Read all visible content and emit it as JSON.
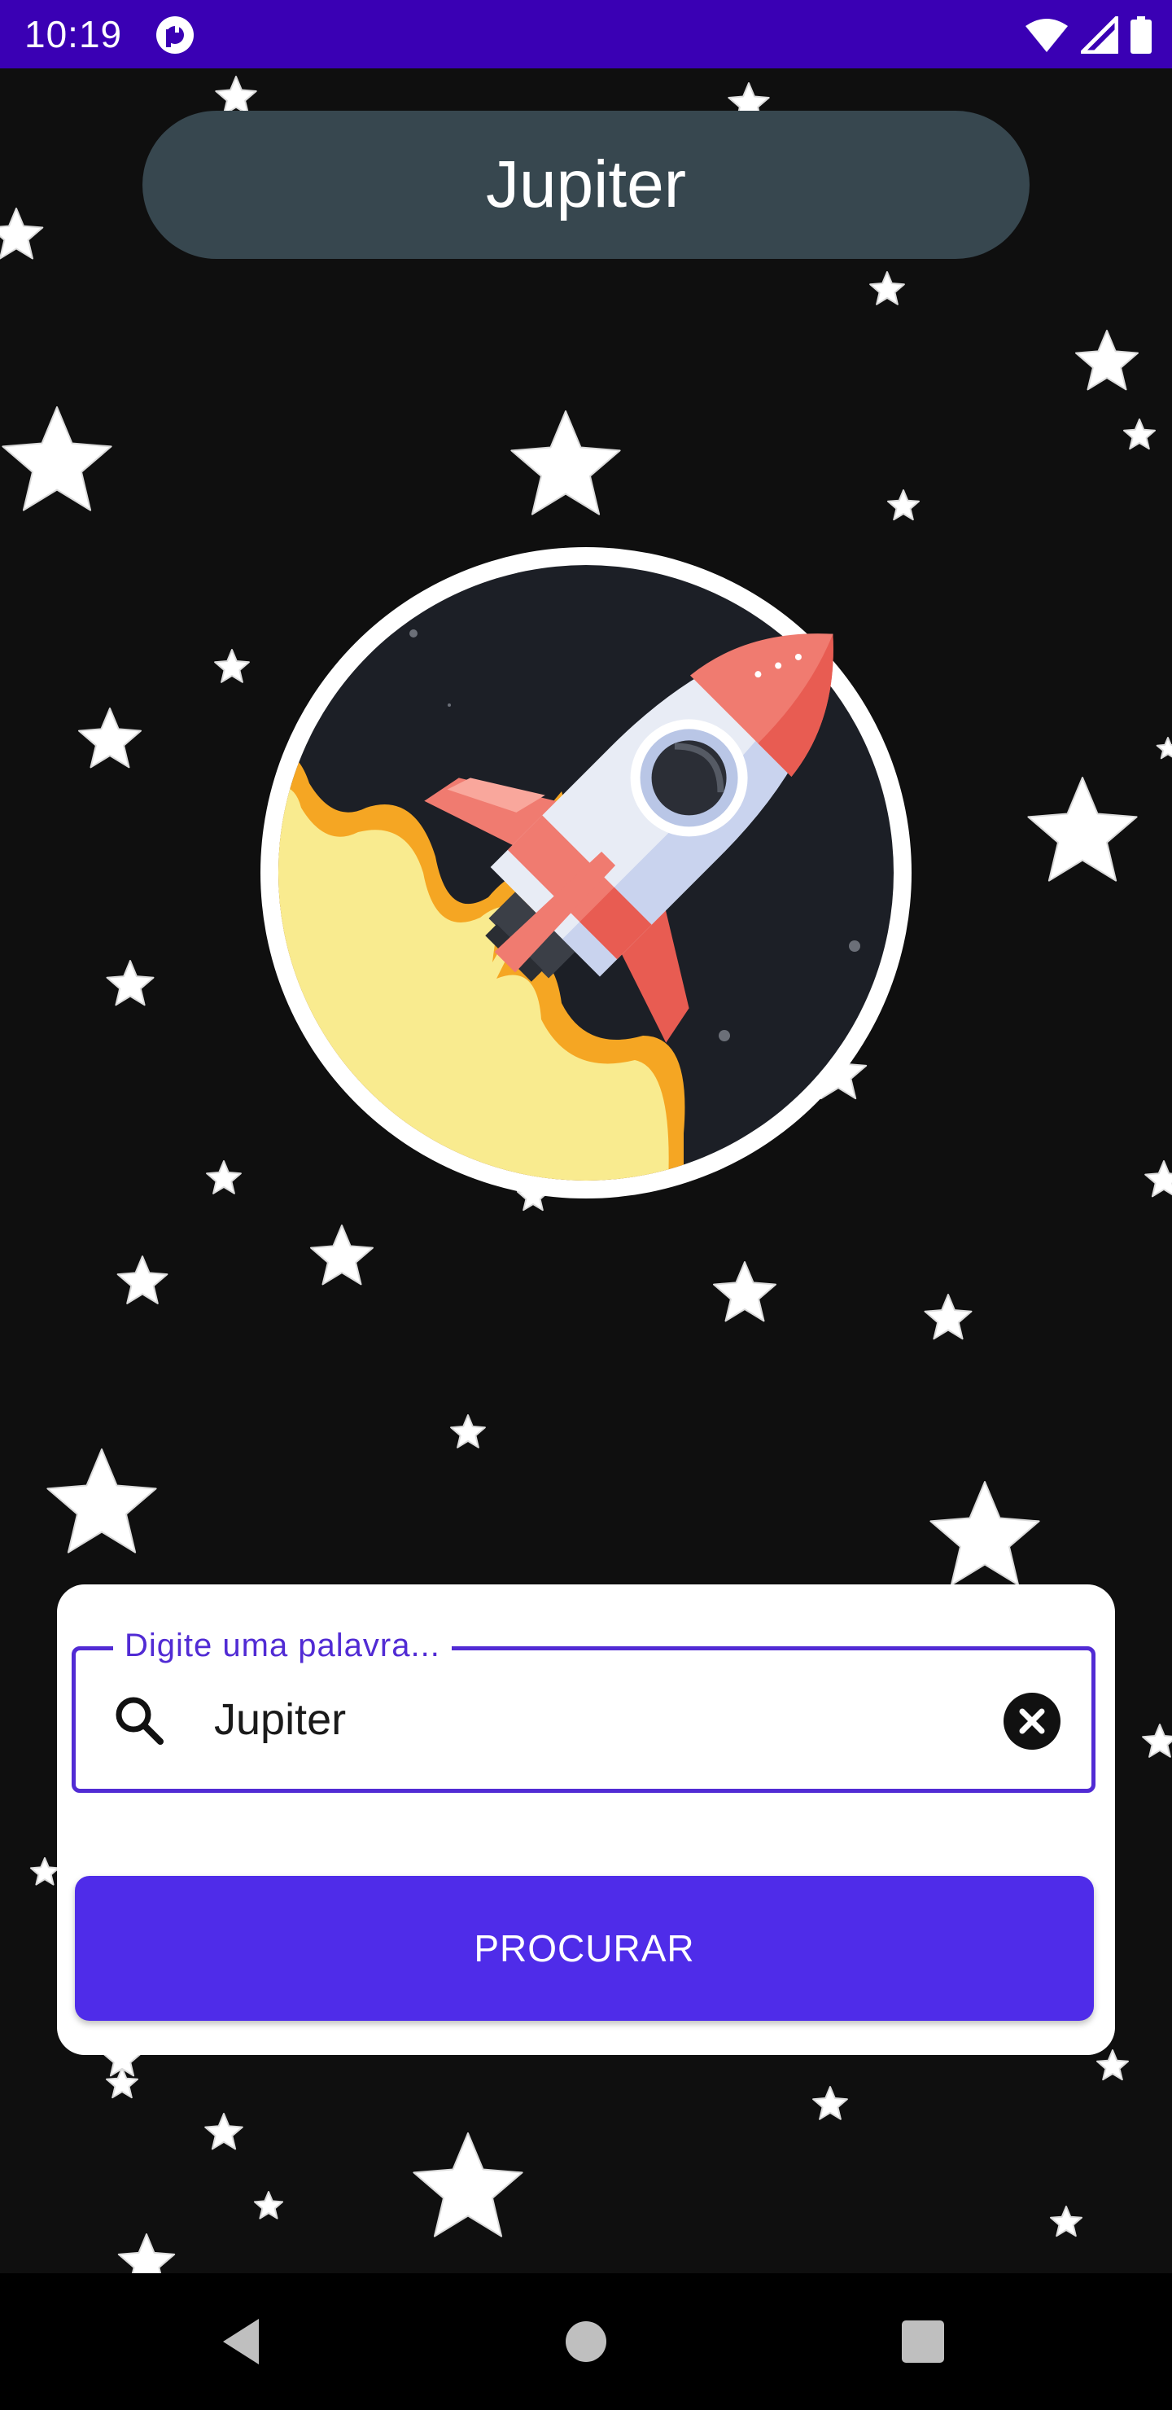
{
  "status_bar": {
    "time": "10:19",
    "background_color": "#3a00b4",
    "app_icon": "app-logo-icon",
    "icons": [
      "wifi-icon",
      "signal-icon",
      "battery-icon"
    ]
  },
  "header": {
    "title": "Jupiter",
    "pill_color": "#37474f"
  },
  "hero": {
    "icon": "rocket-launch-icon"
  },
  "search": {
    "label": "Digite uma palavra...",
    "value": "Jupiter",
    "search_icon": "search-icon",
    "clear_icon": "clear-icon",
    "accent_color": "#512bd4"
  },
  "button": {
    "label": "PROCURAR",
    "color": "#4f2ce9"
  },
  "nav_bar": {
    "buttons": [
      "back-icon",
      "home-icon",
      "recents-icon"
    ]
  }
}
